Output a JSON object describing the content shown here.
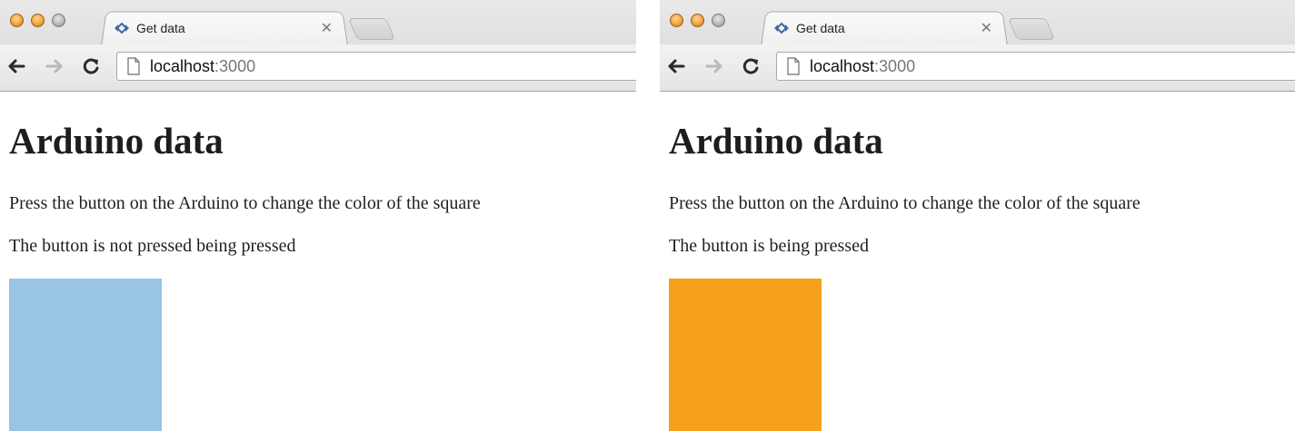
{
  "windows": [
    {
      "tab_title": "Get data",
      "url_host": "localhost",
      "url_port": ":3000",
      "heading": "Arduino data",
      "instruction": "Press the button on the Arduino to change the color of the square",
      "status": "The button is not pressed being pressed",
      "square_color": "#99c4e3"
    },
    {
      "tab_title": "Get data",
      "url_host": "localhost",
      "url_port": ":3000",
      "heading": "Arduino data",
      "instruction": "Press the button on the Arduino to change the color of the square",
      "status": "The button is being pressed",
      "square_color": "#f5a11e"
    }
  ],
  "icons": {
    "traffic_lights": [
      "close-light",
      "minimize-light",
      "zoom-light"
    ],
    "tab_favicon": "diamond-arrows-icon",
    "tab_close": "close-icon",
    "back": "back-arrow-icon",
    "forward": "forward-arrow-icon",
    "reload": "reload-icon",
    "page": "page-icon"
  }
}
